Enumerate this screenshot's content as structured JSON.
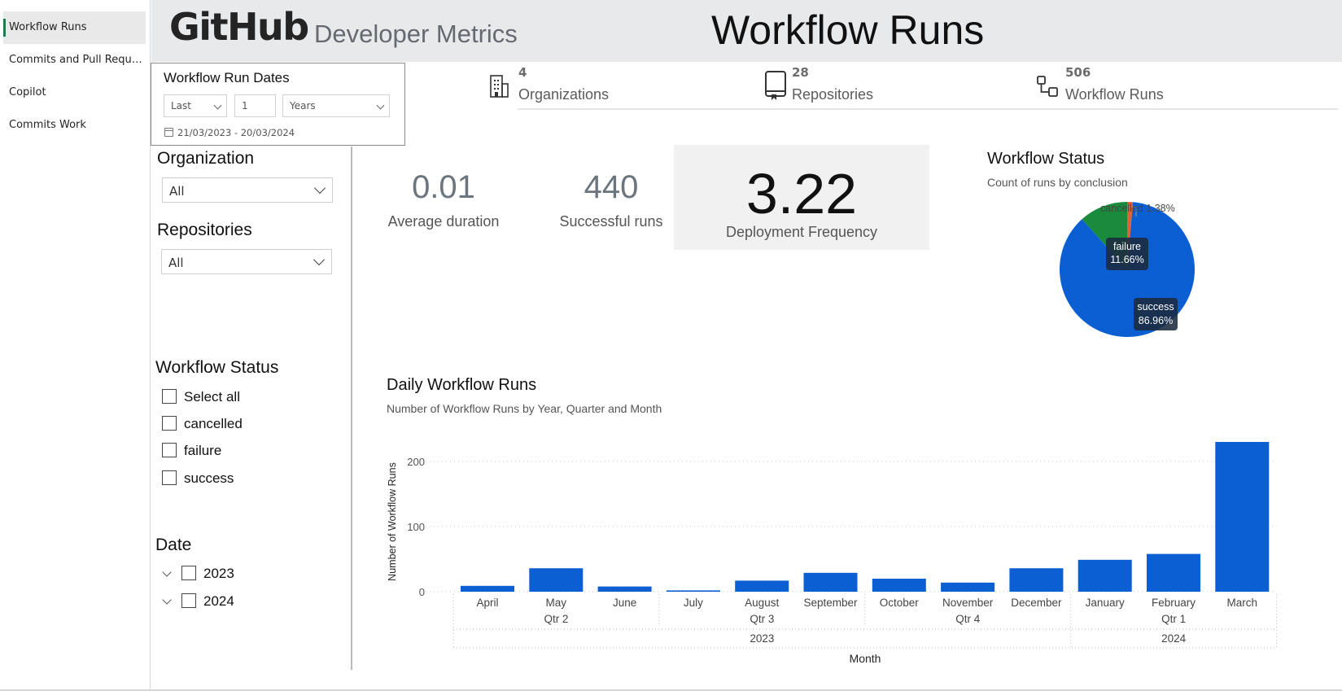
{
  "nav": {
    "items": [
      {
        "label": "Workflow Runs",
        "active": true
      },
      {
        "label": "Commits and Pull Requests",
        "active": false
      },
      {
        "label": "Copilot",
        "active": false
      },
      {
        "label": "Commits Work",
        "active": false
      }
    ]
  },
  "header": {
    "logo_text": "GitHub",
    "logo_subtitle": "Developer Metrics",
    "page_title": "Workflow Runs",
    "background": "#e8e9eb"
  },
  "date_slicer": {
    "title": "Workflow Run Dates",
    "mode": "Last",
    "count": "1",
    "unit": "Years",
    "range": "21/03/2023 - 20/03/2024"
  },
  "filters": {
    "organization": {
      "label": "Organization",
      "value": "All"
    },
    "repositories": {
      "label": "Repositories",
      "value": "All"
    },
    "workflow_status": {
      "label": "Workflow Status",
      "options": [
        "Select all",
        "cancelled",
        "failure",
        "success"
      ]
    },
    "date": {
      "label": "Date",
      "years": [
        "2023",
        "2024"
      ]
    }
  },
  "top_kpis": [
    {
      "value": "4",
      "label": "Organizations",
      "icon": "building-icon"
    },
    {
      "value": "28",
      "label": "Repositories",
      "icon": "repository-icon"
    },
    {
      "value": "506",
      "label": "Workflow Runs",
      "icon": "workflow-icon"
    }
  ],
  "cards": {
    "avg_duration": {
      "value": "0.01",
      "label": "Average duration"
    },
    "successful_runs": {
      "value": "440",
      "label": "Successful runs"
    },
    "deployment_frequency": {
      "value": "3.22",
      "label": "Deployment Frequency"
    }
  },
  "pie": {
    "title": "Workflow Status",
    "subtitle": "Count of runs by conclusion",
    "labels": {
      "cancelled": "cancelled 1.38%",
      "failure_name": "failure",
      "failure_pct": "11.66%",
      "success_name": "success",
      "success_pct": "86.96%"
    }
  },
  "bar": {
    "title": "Daily Workflow Runs",
    "subtitle": "Number of Workflow Runs by Year, Quarter and Month",
    "ylabel": "Number of Workflow Runs",
    "xlabel": "Month",
    "quarters": [
      "Qtr 2",
      "Qtr 3",
      "Qtr 4",
      "Qtr 1"
    ],
    "years": [
      "2023",
      "2024"
    ]
  },
  "colors": {
    "accent": "#1f7a4d",
    "bar": "#0b5fd3",
    "success": "#0b5fd3",
    "failure": "#1a8a3c",
    "cancelled": "#e0623a"
  },
  "chart_data": [
    {
      "type": "pie",
      "title": "Workflow Status",
      "subtitle": "Count of runs by conclusion",
      "categories": [
        "success",
        "failure",
        "cancelled"
      ],
      "values": [
        86.96,
        11.66,
        1.38
      ],
      "colors": [
        "#0b5fd3",
        "#1a8a3c",
        "#e0623a"
      ]
    },
    {
      "type": "bar",
      "title": "Daily Workflow Runs",
      "subtitle": "Number of Workflow Runs by Year, Quarter and Month",
      "xlabel": "Month",
      "ylabel": "Number of Workflow Runs",
      "categories": [
        "April",
        "May",
        "June",
        "July",
        "August",
        "September",
        "October",
        "November",
        "December",
        "January",
        "February",
        "March"
      ],
      "values": [
        9,
        36,
        8,
        2,
        17,
        29,
        20,
        14,
        36,
        49,
        58,
        230
      ],
      "ylim": [
        0,
        240
      ],
      "yticks": [
        0,
        100,
        200
      ],
      "grid": true
    }
  ]
}
